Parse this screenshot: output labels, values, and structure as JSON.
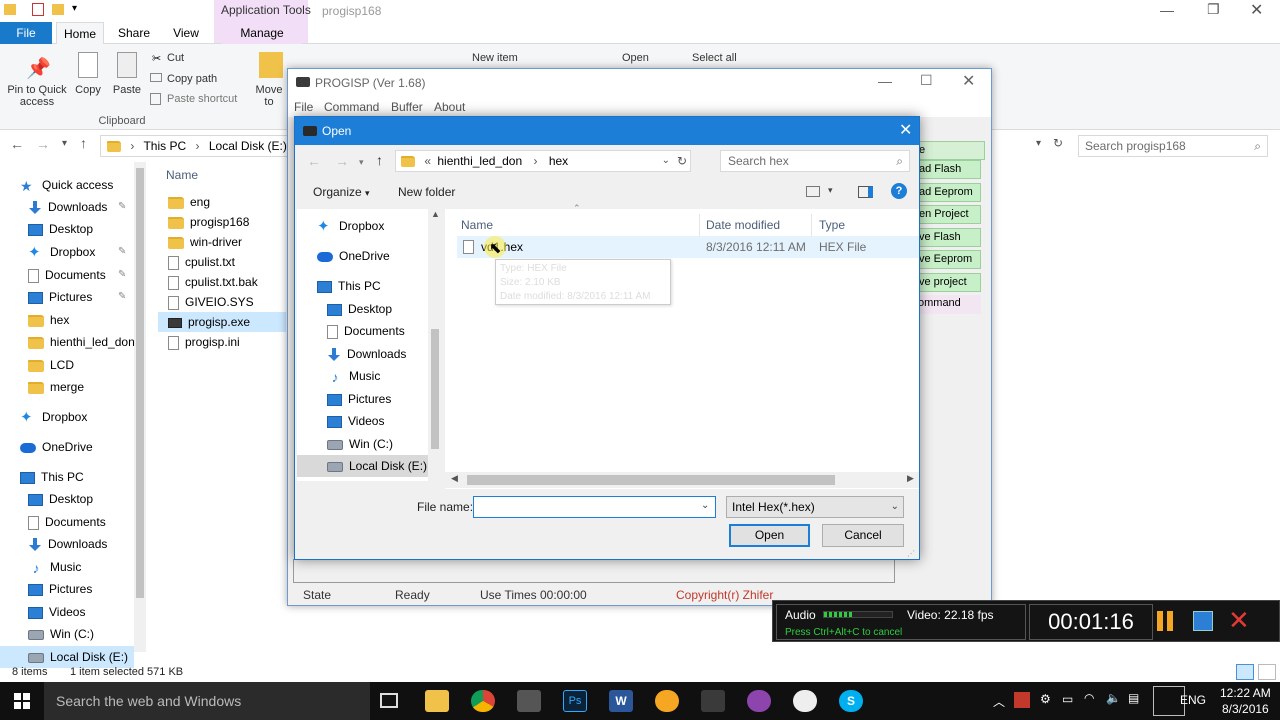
{
  "explorer": {
    "qat": {
      "tools_tab": "Application Tools",
      "title": "progisp168"
    },
    "tabs": {
      "file": "File",
      "home": "Home",
      "share": "Share",
      "view": "View",
      "manage": "Manage"
    },
    "ribbon": {
      "pin": "Pin to Quick access",
      "copy": "Copy",
      "paste": "Paste",
      "cut": "Cut",
      "copy_path": "Copy path",
      "paste_shortcut": "Paste shortcut",
      "clipboard": "Clipboard",
      "move_to": "Move to",
      "new_item": "New item",
      "open": "Open",
      "select_all": "Select all"
    },
    "address": {
      "this_pc": "This PC",
      "local_disk": "Local Disk (E:)",
      "search_placeholder": "Search progisp168"
    },
    "nav": [
      {
        "label": "Quick access",
        "icon": "star-icon"
      },
      {
        "label": "Downloads",
        "icon": "download-icon"
      },
      {
        "label": "Desktop",
        "icon": "desktop-icon"
      },
      {
        "label": "Dropbox",
        "icon": "dropbox-icon"
      },
      {
        "label": "Documents",
        "icon": "documents-icon"
      },
      {
        "label": "Pictures",
        "icon": "pictures-icon"
      },
      {
        "label": "hex",
        "icon": "folder-icon"
      },
      {
        "label": "hienthi_led_don",
        "icon": "folder-icon"
      },
      {
        "label": "LCD",
        "icon": "folder-icon"
      },
      {
        "label": "merge",
        "icon": "folder-icon"
      },
      {
        "label": "Dropbox",
        "icon": "dropbox-icon"
      },
      {
        "label": "OneDrive",
        "icon": "onedrive-icon"
      },
      {
        "label": "This PC",
        "icon": "computer-icon"
      },
      {
        "label": "Desktop",
        "icon": "desktop-icon"
      },
      {
        "label": "Documents",
        "icon": "documents-icon"
      },
      {
        "label": "Downloads",
        "icon": "download-icon"
      },
      {
        "label": "Music",
        "icon": "music-icon"
      },
      {
        "label": "Pictures",
        "icon": "pictures-icon"
      },
      {
        "label": "Videos",
        "icon": "videos-icon"
      },
      {
        "label": "Win (C:)",
        "icon": "drive-icon"
      },
      {
        "label": "Local Disk (E:)",
        "icon": "drive-icon"
      }
    ],
    "list_header": "Name",
    "files": [
      {
        "name": "eng",
        "icon": "folder-icon"
      },
      {
        "name": "progisp168",
        "icon": "folder-icon"
      },
      {
        "name": "win-driver",
        "icon": "folder-icon"
      },
      {
        "name": "cpulist.txt",
        "icon": "file-icon"
      },
      {
        "name": "cpulist.txt.bak",
        "icon": "file-icon"
      },
      {
        "name": "GIVEIO.SYS",
        "icon": "file-icon"
      },
      {
        "name": "progisp.exe",
        "icon": "app-icon"
      },
      {
        "name": "progisp.ini",
        "icon": "file-icon"
      }
    ],
    "status": {
      "items": "8 items",
      "selected": "1 item selected  571 KB"
    }
  },
  "progisp": {
    "title": "PROGISP (Ver 1.68)",
    "menu": [
      "File",
      "Command",
      "Buffer",
      "About"
    ],
    "buttons": [
      "e",
      "ad Flash",
      "ad Eeprom",
      "en Project",
      "ve Flash",
      "ve Eeprom",
      "ve project",
      "ommand"
    ],
    "status": {
      "state": "State",
      "ready": "Ready",
      "use_times": "Use Times",
      "time": "00:00:00",
      "copyright": "Copyright(r) Zhifer"
    }
  },
  "dialog": {
    "title": "Open",
    "path": [
      "hienthi_led_don",
      "hex"
    ],
    "search_placeholder": "Search hex",
    "organize": "Organize",
    "new_folder": "New folder",
    "tree": [
      {
        "label": "Dropbox",
        "icon": "dropbox-icon"
      },
      {
        "label": "OneDrive",
        "icon": "onedrive-icon"
      },
      {
        "label": "This PC",
        "icon": "computer-icon"
      },
      {
        "label": "Desktop",
        "icon": "desktop-icon"
      },
      {
        "label": "Documents",
        "icon": "documents-icon"
      },
      {
        "label": "Downloads",
        "icon": "download-icon"
      },
      {
        "label": "Music",
        "icon": "music-icon"
      },
      {
        "label": "Pictures",
        "icon": "pictures-icon"
      },
      {
        "label": "Videos",
        "icon": "videos-icon"
      },
      {
        "label": "Win (C:)",
        "icon": "drive-icon"
      },
      {
        "label": "Local Disk (E:)",
        "icon": "drive-icon"
      }
    ],
    "columns": {
      "name": "Name",
      "date": "Date modified",
      "type": "Type"
    },
    "file": {
      "name": "vd1.hex",
      "date": "8/3/2016 12:11 AM",
      "type": "HEX File"
    },
    "tooltip": {
      "type": "Type: HEX File",
      "size": "Size: 2.10 KB",
      "modified": "Date modified: 8/3/2016 12:11 AM"
    },
    "filename_label": "File name:",
    "filename_value": "",
    "filter": "Intel Hex(*.hex)",
    "open_btn": "Open",
    "cancel_btn": "Cancel"
  },
  "recorder": {
    "audio": "Audio",
    "video": "Video: 22.18 fps",
    "cancel_hint": "Press Ctrl+Alt+C to cancel",
    "timer": "00:01:16"
  },
  "taskbar": {
    "search": "Search the web and Windows",
    "lang": "ENG",
    "time": "12:22 AM",
    "date": "8/3/2016"
  }
}
